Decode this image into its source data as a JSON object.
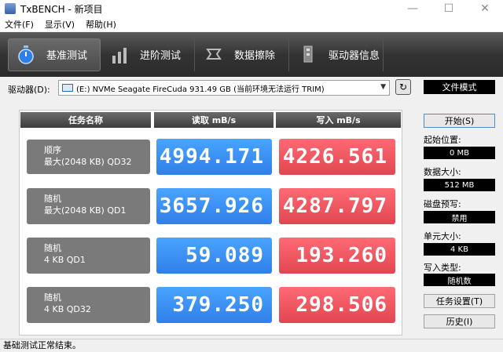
{
  "window": {
    "title": "TxBENCH - 新项目",
    "minimize": "—",
    "maximize": "☐",
    "close": "✕"
  },
  "menu": [
    "文件(F)",
    "显示(V)",
    "帮助(H)"
  ],
  "toolbar": {
    "tabs": [
      {
        "label": "基准测试",
        "icon": "stopwatch-icon",
        "active": true
      },
      {
        "label": "进阶测试",
        "icon": "bar-chart-icon",
        "active": false
      },
      {
        "label": "数据擦除",
        "icon": "eraser-icon",
        "active": false
      },
      {
        "label": "驱动器信息",
        "icon": "drive-info-icon",
        "active": false
      }
    ]
  },
  "drive": {
    "label": "驱动器(D):",
    "selected": "(E:) NVMe Seagate FireCuda  931.49 GB (当前环境无法运行 TRIM)"
  },
  "table": {
    "headers": {
      "name": "任务名称",
      "read": "读取 mB/s",
      "write": "写入 mB/s"
    },
    "rows": [
      {
        "line1": "顺序",
        "line2": "最大(2048 KB) QD32",
        "read": "4994.171",
        "write": "4226.561"
      },
      {
        "line1": "随机",
        "line2": "最大(2048 KB) QD1",
        "read": "3657.926",
        "write": "4287.797"
      },
      {
        "line1": "随机",
        "line2": "4 KB QD1",
        "read": "59.089",
        "write": "193.260"
      },
      {
        "line1": "随机",
        "line2": "4 KB QD32",
        "read": "379.250",
        "write": "298.506"
      }
    ]
  },
  "side": {
    "mode": "文件模式",
    "start": "开始(S)",
    "start_pos_label": "起始位置:",
    "start_pos": "0 MB",
    "data_size_label": "数据大小:",
    "data_size": "512 MB",
    "precondition_label": "磁盘预写:",
    "precondition": "禁用",
    "unit_size_label": "单元大小:",
    "unit_size": "4 KB",
    "write_type_label": "写入类型:",
    "write_type": "随机数",
    "task_settings": "任务设置(T)",
    "history": "历史(I)"
  },
  "status": "基础测试正常结束。",
  "colors": {
    "read": "#2f7fe8",
    "write": "#e04650",
    "toolbar": "#333333"
  }
}
